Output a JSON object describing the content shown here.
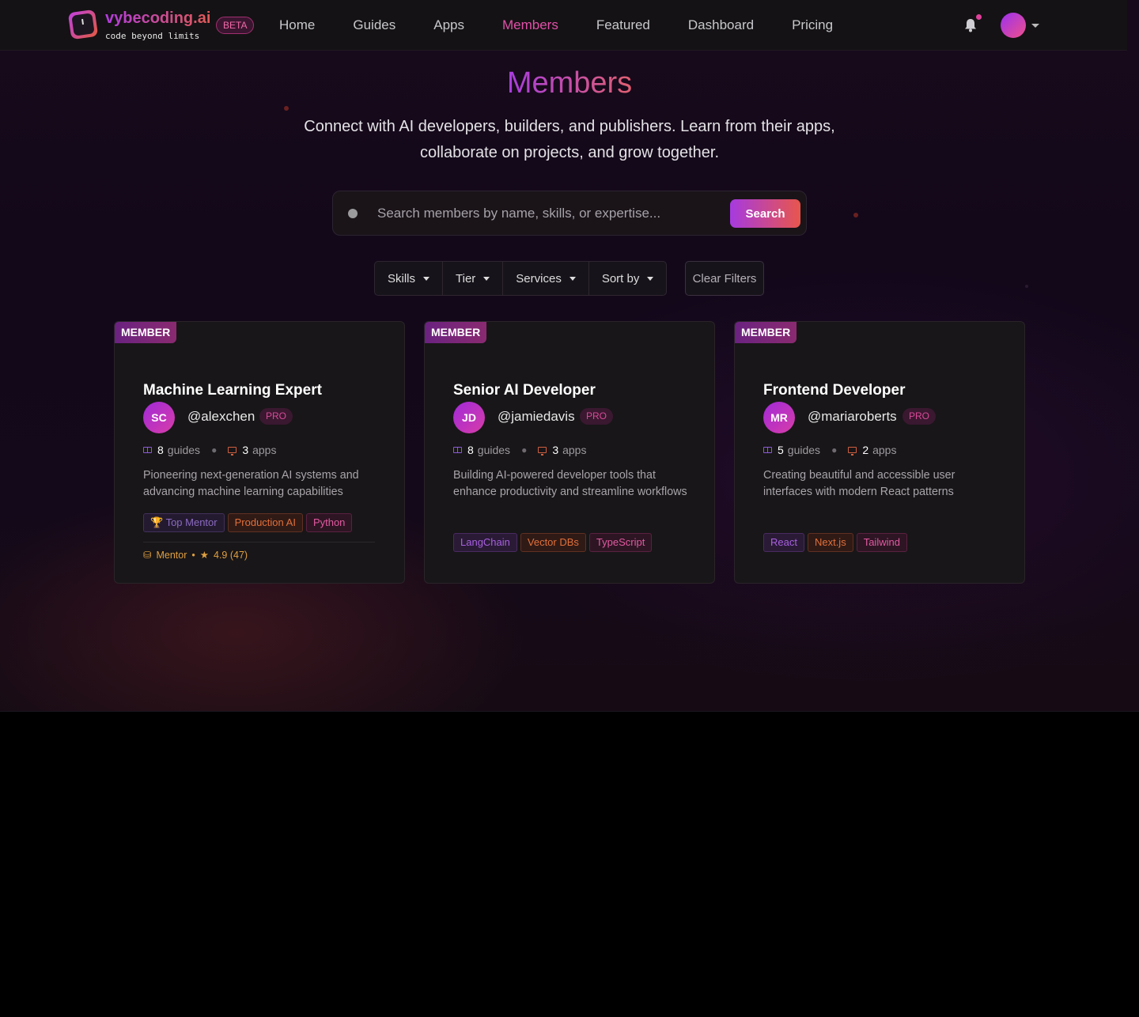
{
  "nav": {
    "brand": "vybecoding.ai",
    "tagline": "code beyond limits",
    "beta": "BETA",
    "links": [
      {
        "label": "Home",
        "active": false
      },
      {
        "label": "Guides",
        "active": false
      },
      {
        "label": "Apps",
        "active": false
      },
      {
        "label": "Members",
        "active": true
      },
      {
        "label": "Featured",
        "active": false
      },
      {
        "label": "Dashboard",
        "active": false
      },
      {
        "label": "Pricing",
        "active": false
      }
    ],
    "icons": [
      "bell-icon",
      "avatar",
      "chevron-down-icon"
    ]
  },
  "hero": {
    "title": "Members",
    "subtitle_line1": "Connect with AI developers, builders, and publishers. Learn from their apps,",
    "subtitle_line2": "collaborate on projects, and grow together."
  },
  "search": {
    "placeholder": "Search members by name, skills, or expertise...",
    "button": "Search"
  },
  "filters": {
    "items": [
      "Skills",
      "Tier",
      "Services",
      "Sort by"
    ],
    "clear": "Clear Filters"
  },
  "members": [
    {
      "badge": "MEMBER",
      "title": "Machine Learning Expert",
      "initials": "SC",
      "handle": "@alexchen",
      "tier": "PRO",
      "guides": "8",
      "guides_label": "guides",
      "apps": "3",
      "apps_label": "apps",
      "description": "Pioneering next-generation AI systems and advancing machine learning capabilities",
      "tags": [
        {
          "label": "🏆 Top Mentor",
          "style": "mentor"
        },
        {
          "label": "Production AI",
          "style": "orange"
        },
        {
          "label": "Python",
          "style": "pink"
        }
      ],
      "footer_role": "Mentor",
      "footer_rating": "4.9 (47)"
    },
    {
      "badge": "MEMBER",
      "title": "Senior AI Developer",
      "initials": "JD",
      "handle": "@jamiedavis",
      "tier": "PRO",
      "guides": "8",
      "guides_label": "guides",
      "apps": "3",
      "apps_label": "apps",
      "description": "Building AI-powered developer tools that enhance productivity and streamline workflows",
      "tags": [
        {
          "label": "LangChain",
          "style": "purple"
        },
        {
          "label": "Vector DBs",
          "style": "orange"
        },
        {
          "label": "TypeScript",
          "style": "pink"
        }
      ]
    },
    {
      "badge": "MEMBER",
      "title": "Frontend Developer",
      "initials": "MR",
      "handle": "@mariaroberts",
      "tier": "PRO",
      "guides": "5",
      "guides_label": "guides",
      "apps": "2",
      "apps_label": "apps",
      "description": "Creating beautiful and accessible user interfaces with modern React patterns",
      "tags": [
        {
          "label": "React",
          "style": "purple"
        },
        {
          "label": "Next.js",
          "style": "orange"
        },
        {
          "label": "Tailwind",
          "style": "pink"
        }
      ]
    }
  ],
  "colors": {
    "accent_purple": "#a63ae0",
    "accent_pink": "#e050a8",
    "accent_orange": "#e8564c",
    "background": "#12081a"
  }
}
